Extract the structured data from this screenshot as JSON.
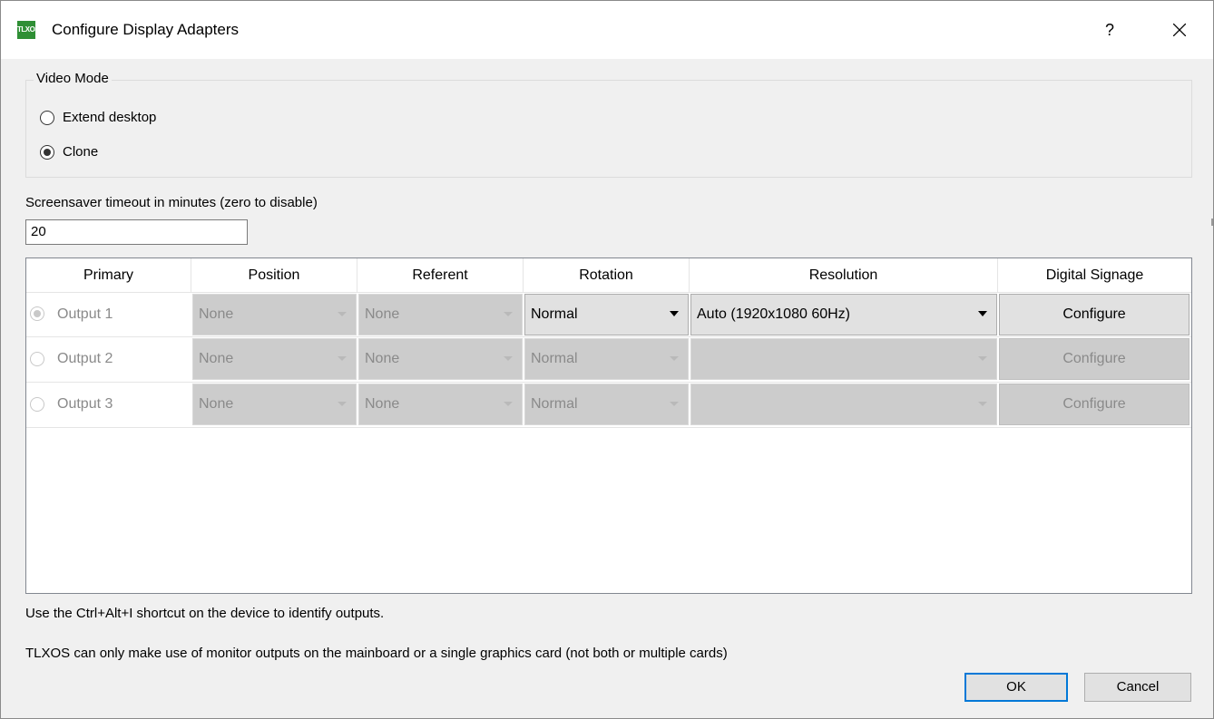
{
  "window": {
    "title": "Configure Display Adapters",
    "icon_text": "TLXOS",
    "help_label": "?",
    "close_icon": "close-icon"
  },
  "video_mode": {
    "label": "Video Mode",
    "options": [
      {
        "label": "Extend desktop",
        "checked": false
      },
      {
        "label": "Clone",
        "checked": true
      }
    ]
  },
  "screensaver": {
    "label": "Screensaver timeout in minutes (zero to disable)",
    "value": "20"
  },
  "table": {
    "headers": [
      "Primary",
      "Position",
      "Referent",
      "Rotation",
      "Resolution",
      "Digital Signage"
    ],
    "rows": [
      {
        "output": "Output 1",
        "primary": true,
        "position": "None",
        "referent": "None",
        "rotation": "Normal",
        "resolution": "Auto (1920x1080 60Hz)",
        "signage": "Configure",
        "enabled": true
      },
      {
        "output": "Output 2",
        "primary": false,
        "position": "None",
        "referent": "None",
        "rotation": "Normal",
        "resolution": "",
        "signage": "Configure",
        "enabled": false
      },
      {
        "output": "Output 3",
        "primary": false,
        "position": "None",
        "referent": "None",
        "rotation": "Normal",
        "resolution": "",
        "signage": "Configure",
        "enabled": false
      }
    ]
  },
  "notes": {
    "shortcut": "Use the Ctrl+Alt+I shortcut on the device to identify outputs.",
    "limitation": "TLXOS can only make use of monitor outputs on the mainboard or a single graphics card (not both or multiple cards)"
  },
  "buttons": {
    "ok": "OK",
    "cancel": "Cancel"
  },
  "colors": {
    "accent": "#0078d7",
    "disabled_fill": "#cccccc",
    "icon_green": "#2f8f35"
  }
}
